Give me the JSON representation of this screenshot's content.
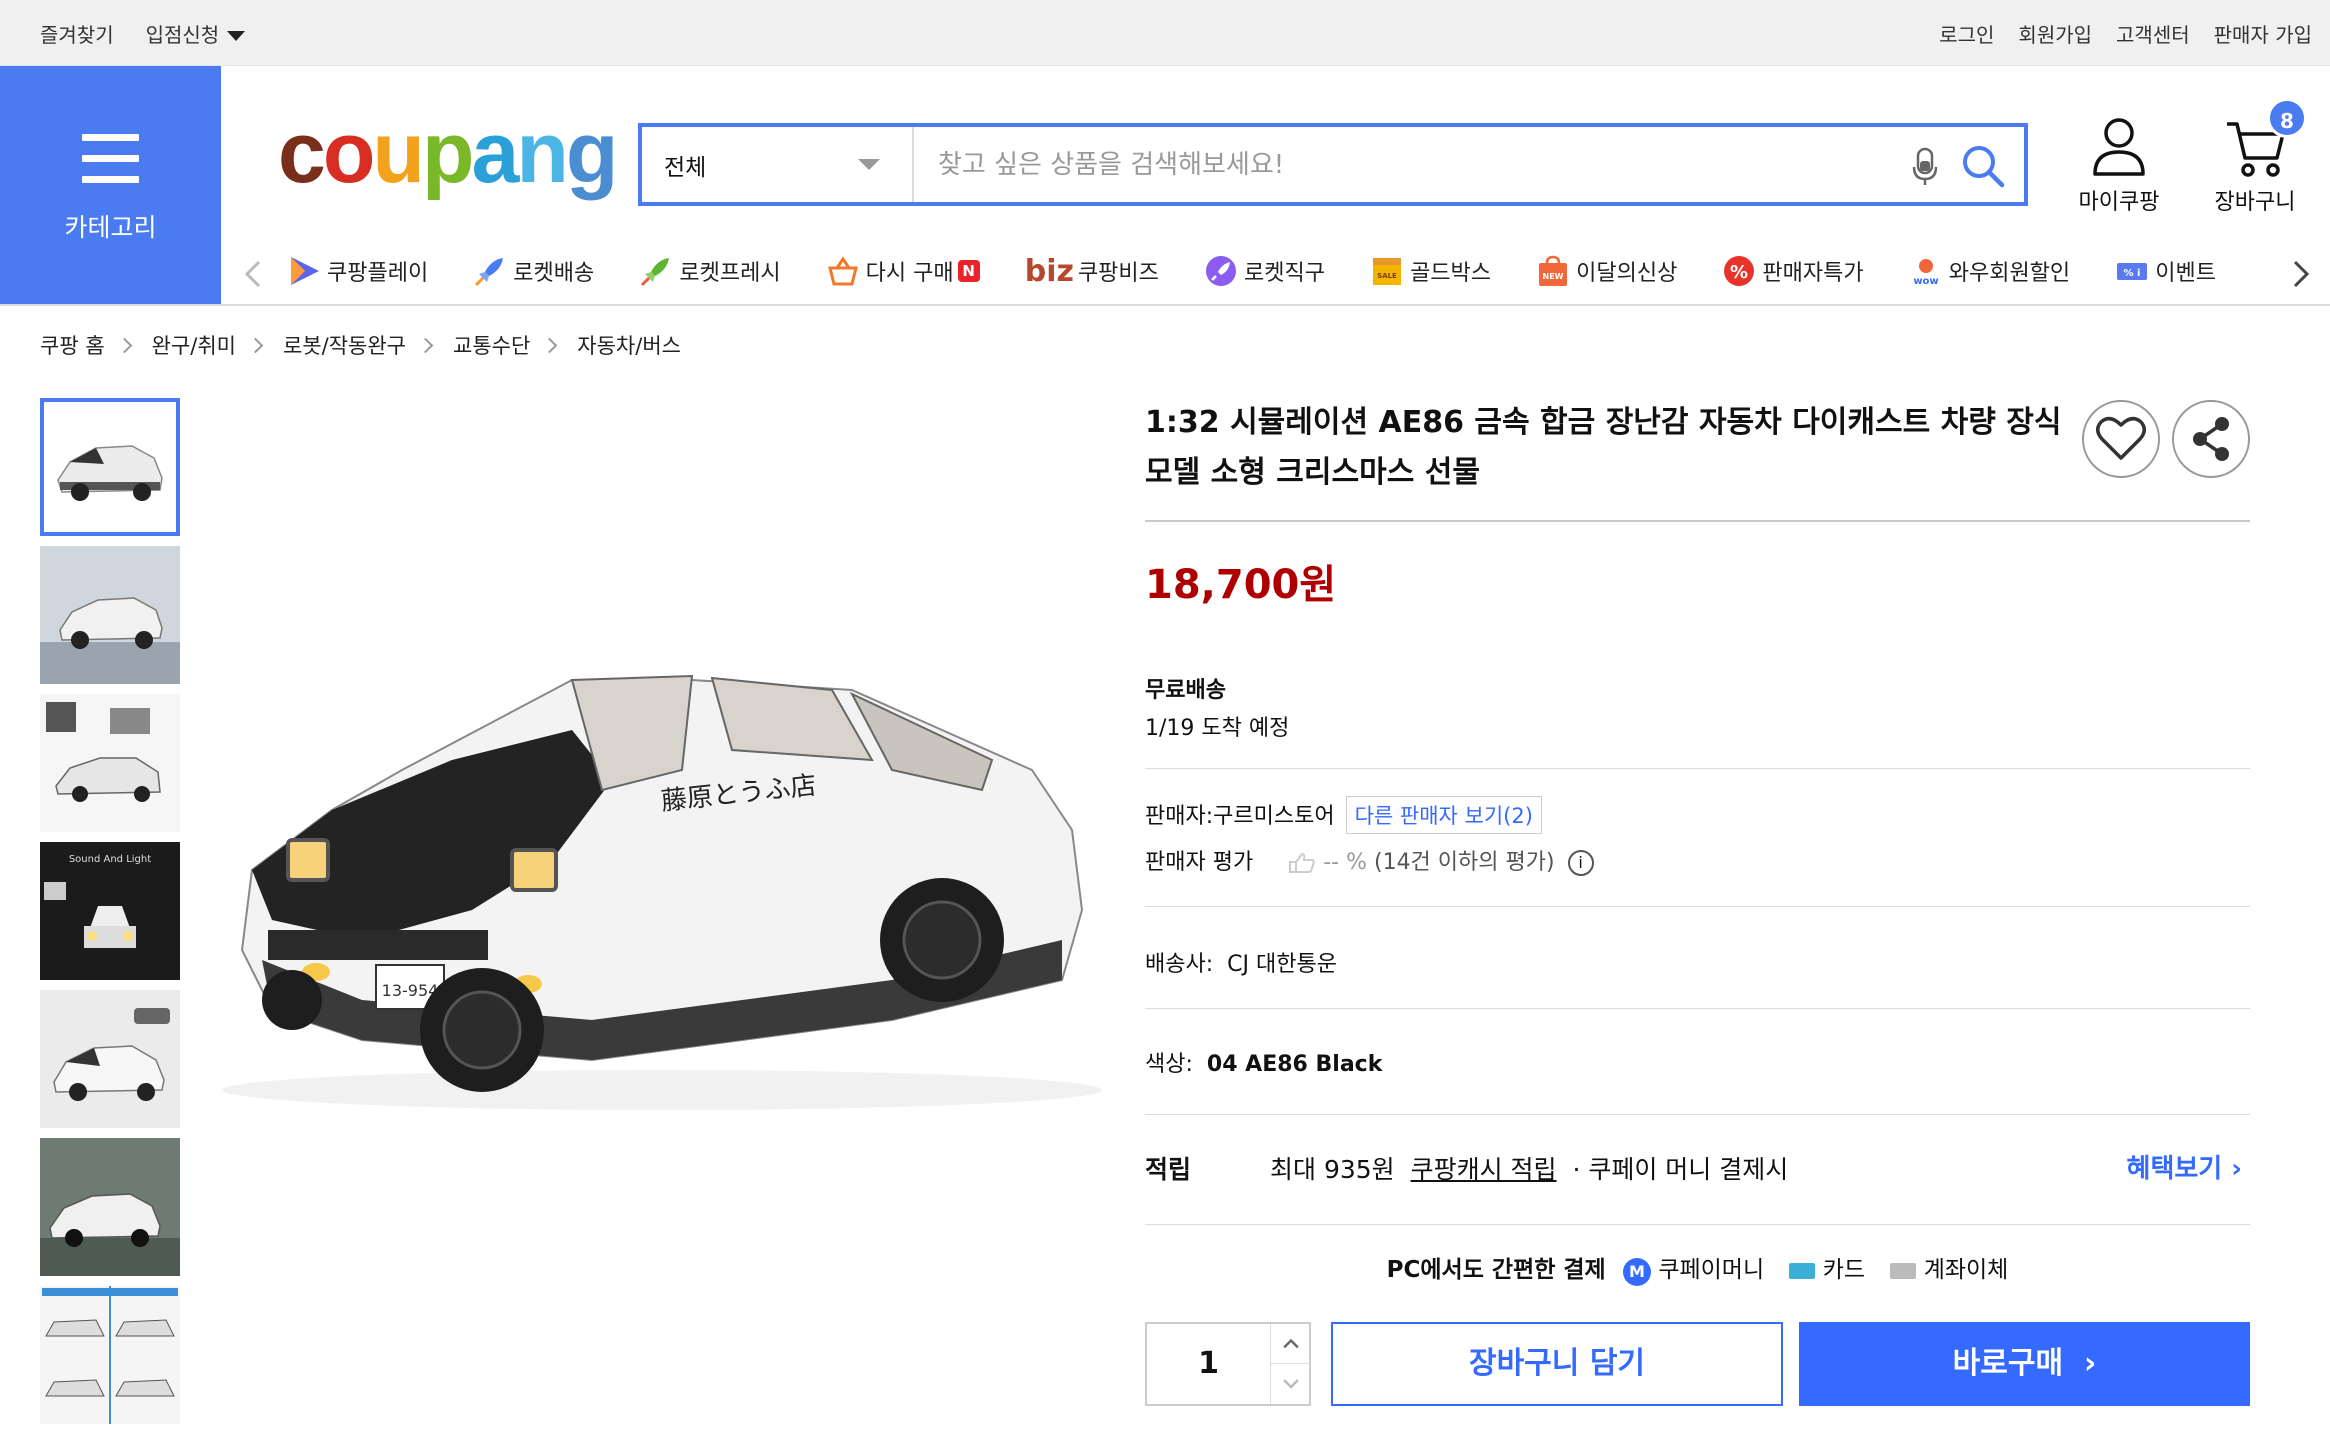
{
  "topbar": {
    "favorites": "즐겨찾기",
    "vendor_apply": "입점신청",
    "login": "로그인",
    "signup": "회원가입",
    "customer_center": "고객센터",
    "seller_signup": "판매자 가입"
  },
  "header": {
    "category_label": "카테고리",
    "logo": "coupang",
    "search": {
      "category": "전체",
      "placeholder": "찾고 싶은 상품을 검색해보세요!"
    },
    "my_coupang": "마이쿠팡",
    "cart": "장바구니",
    "cart_count": "8",
    "accent_color": "#4a7bf0"
  },
  "service_nav": [
    {
      "icon": "play-icon",
      "label": "쿠팡플레이"
    },
    {
      "icon": "rocket-icon",
      "label": "로켓배송"
    },
    {
      "icon": "rocket-fresh-icon",
      "label": "로켓프레시"
    },
    {
      "icon": "basket-icon",
      "label": "다시 구매",
      "badge": "N"
    },
    {
      "icon": "biz-icon",
      "prefix": "biz",
      "label": "쿠팡비즈"
    },
    {
      "icon": "rocket-global-icon",
      "label": "로켓직구"
    },
    {
      "icon": "gold-box-icon",
      "label": "골드박스"
    },
    {
      "icon": "new-bag-icon",
      "label": "이달의신상"
    },
    {
      "icon": "percent-icon",
      "label": "판매자특가"
    },
    {
      "icon": "wow-icon",
      "label": "와우회원할인"
    },
    {
      "icon": "event-icon",
      "label": "이벤트"
    }
  ],
  "breadcrumb": [
    "쿠팡 홈",
    "완구/취미",
    "로봇/작동완구",
    "교통수단",
    "자동차/버스"
  ],
  "product": {
    "title": "1:32 시뮬레이션 AE86 금속 합금 장난감 자동차 다이캐스트 차량 장식 모델 소형 크리스마스 선물",
    "price": "18,700원",
    "price_color": "#ae0000",
    "shipping_label": "무료배송",
    "arrival": "1/19 도착 예정",
    "seller_label": "판매자:",
    "seller_name": "구르미스토어",
    "other_sellers": "다른 판매자 보기(2)",
    "seller_rating_label": "판매자 평가",
    "seller_rating_value": "-- %",
    "seller_rating_note": "(14건 이하의 평가)",
    "carrier_label": "배송사:",
    "carrier": "CJ 대한통운",
    "color_label": "색상:",
    "color_value": "04 AE86 Black",
    "reward_label": "적립",
    "reward_max": "최대 935원",
    "reward_link": "쿠팡캐시 적립",
    "reward_condition": "· 쿠페이 머니 결제시",
    "benefit_link": "혜택보기",
    "pay_intro": "PC에서도 간편한 결제",
    "pay_methods": [
      "쿠페이머니",
      "카드",
      "계좌이체"
    ],
    "quantity": "1",
    "add_to_cart": "장바구니 담기",
    "buy_now": "바로구매"
  }
}
